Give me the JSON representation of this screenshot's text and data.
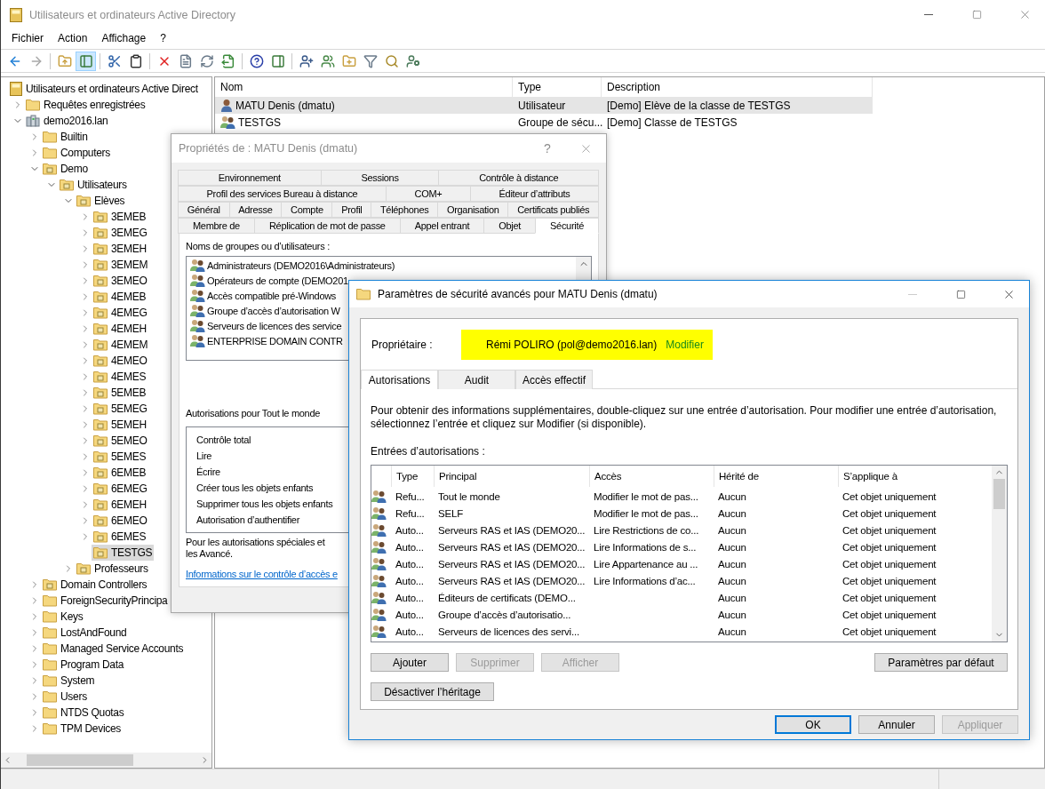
{
  "main_window": {
    "title": "Utilisateurs et ordinateurs Active Directory",
    "menu": [
      "Fichier",
      "Action",
      "Affichage",
      "?"
    ],
    "toolbar": [
      {
        "kind": "back",
        "pressed": false,
        "disabled": false
      },
      {
        "kind": "forward",
        "pressed": false,
        "disabled": true
      },
      {
        "kind": "separator"
      },
      {
        "kind": "up",
        "pressed": false,
        "disabled": false
      },
      {
        "kind": "tree",
        "pressed": true,
        "disabled": false
      },
      {
        "kind": "separator"
      },
      {
        "kind": "cut",
        "pressed": false,
        "disabled": false
      },
      {
        "kind": "paste",
        "pressed": false,
        "disabled": false
      },
      {
        "kind": "separator"
      },
      {
        "kind": "delete",
        "pressed": false,
        "disabled": false
      },
      {
        "kind": "properties",
        "pressed": false,
        "disabled": false
      },
      {
        "kind": "refresh",
        "pressed": false,
        "disabled": false
      },
      {
        "kind": "export",
        "pressed": false,
        "disabled": false
      },
      {
        "kind": "separator"
      },
      {
        "kind": "help",
        "pressed": false,
        "disabled": false
      },
      {
        "kind": "action_pane",
        "pressed": false,
        "disabled": false
      },
      {
        "kind": "separator"
      },
      {
        "kind": "new_user",
        "pressed": false,
        "disabled": false
      },
      {
        "kind": "new_group",
        "pressed": false,
        "disabled": false
      },
      {
        "kind": "new_ou",
        "pressed": false,
        "disabled": false
      },
      {
        "kind": "filter",
        "pressed": false,
        "disabled": false
      },
      {
        "kind": "find",
        "pressed": false,
        "disabled": false
      },
      {
        "kind": "add_to_group",
        "pressed": false,
        "disabled": false
      }
    ],
    "tree": {
      "label": "Utilisateurs et ordinateurs Active Direct",
      "kind": "snapin",
      "selected": false,
      "children": [
        {
          "label": "Requêtes enregistrées",
          "kind": "folder",
          "expanded": false,
          "selected": false
        },
        {
          "label": "demo2016.lan",
          "kind": "domain",
          "expanded": true,
          "selected": false,
          "children": [
            {
              "label": "Builtin",
              "kind": "folder",
              "expanded": false,
              "selected": false
            },
            {
              "label": "Computers",
              "kind": "folder",
              "expanded": false,
              "selected": false
            },
            {
              "label": "Demo",
              "kind": "ou",
              "expanded": true,
              "selected": false,
              "children": [
                {
                  "label": "Utilisateurs",
                  "kind": "ou",
                  "expanded": true,
                  "selected": false,
                  "children": [
                    {
                      "label": "Elèves",
                      "kind": "ou",
                      "expanded": true,
                      "selected": false,
                      "children": [
                        {
                          "label": "3EMEB",
                          "kind": "ou",
                          "expanded": false,
                          "selected": false
                        },
                        {
                          "label": "3EMEG",
                          "kind": "ou",
                          "expanded": false,
                          "selected": false
                        },
                        {
                          "label": "3EMEH",
                          "kind": "ou",
                          "expanded": false,
                          "selected": false
                        },
                        {
                          "label": "3EMEM",
                          "kind": "ou",
                          "expanded": false,
                          "selected": false
                        },
                        {
                          "label": "3EMEO",
                          "kind": "ou",
                          "expanded": false,
                          "selected": false
                        },
                        {
                          "label": "4EMEB",
                          "kind": "ou",
                          "expanded": false,
                          "selected": false
                        },
                        {
                          "label": "4EMEG",
                          "kind": "ou",
                          "expanded": false,
                          "selected": false
                        },
                        {
                          "label": "4EMEH",
                          "kind": "ou",
                          "expanded": false,
                          "selected": false
                        },
                        {
                          "label": "4EMEM",
                          "kind": "ou",
                          "expanded": false,
                          "selected": false
                        },
                        {
                          "label": "4EMEO",
                          "kind": "ou",
                          "expanded": false,
                          "selected": false
                        },
                        {
                          "label": "4EMES",
                          "kind": "ou",
                          "expanded": false,
                          "selected": false
                        },
                        {
                          "label": "5EMEB",
                          "kind": "ou",
                          "expanded": false,
                          "selected": false
                        },
                        {
                          "label": "5EMEG",
                          "kind": "ou",
                          "expanded": false,
                          "selected": false
                        },
                        {
                          "label": "5EMEH",
                          "kind": "ou",
                          "expanded": false,
                          "selected": false
                        },
                        {
                          "label": "5EMEO",
                          "kind": "ou",
                          "expanded": false,
                          "selected": false
                        },
                        {
                          "label": "5EMES",
                          "kind": "ou",
                          "expanded": false,
                          "selected": false
                        },
                        {
                          "label": "6EMEB",
                          "kind": "ou",
                          "expanded": false,
                          "selected": false
                        },
                        {
                          "label": "6EMEG",
                          "kind": "ou",
                          "expanded": false,
                          "selected": false
                        },
                        {
                          "label": "6EMEH",
                          "kind": "ou",
                          "expanded": false,
                          "selected": false
                        },
                        {
                          "label": "6EMEO",
                          "kind": "ou",
                          "expanded": false,
                          "selected": false
                        },
                        {
                          "label": "6EMES",
                          "kind": "ou",
                          "expanded": false,
                          "selected": false
                        },
                        {
                          "label": "TESTGS",
                          "kind": "ou",
                          "selected": true
                        }
                      ]
                    },
                    {
                      "label": "Professeurs",
                      "kind": "ou",
                      "expanded": false,
                      "selected": false
                    }
                  ]
                }
              ]
            },
            {
              "label": "Domain Controllers",
              "kind": "ou",
              "expanded": false,
              "selected": false
            },
            {
              "label": "ForeignSecurityPrincipa",
              "kind": "folder",
              "expanded": false,
              "selected": false
            },
            {
              "label": "Keys",
              "kind": "folder",
              "expanded": false,
              "selected": false
            },
            {
              "label": "LostAndFound",
              "kind": "folder",
              "expanded": false,
              "selected": false
            },
            {
              "label": "Managed Service Accounts",
              "kind": "folder",
              "expanded": false,
              "selected": false
            },
            {
              "label": "Program Data",
              "kind": "folder",
              "expanded": false,
              "selected": false
            },
            {
              "label": "System",
              "kind": "folder",
              "expanded": false,
              "selected": false
            },
            {
              "label": "Users",
              "kind": "folder",
              "expanded": false,
              "selected": false
            },
            {
              "label": "NTDS Quotas",
              "kind": "folder",
              "expanded": false,
              "selected": false
            },
            {
              "label": "TPM Devices",
              "kind": "folder",
              "expanded": false,
              "selected": false
            }
          ]
        }
      ]
    },
    "list": {
      "columns": [
        "Nom",
        "Type",
        "Description"
      ],
      "rows": [
        {
          "kind": "user",
          "name": "MATU Denis (dmatu)",
          "type": "Utilisateur",
          "description": "[Demo] Elève de la classe de TESTGS",
          "selected": true
        },
        {
          "kind": "group",
          "name": "TESTGS",
          "type": "Groupe de sécu...",
          "description": "[Demo] Classe de TESTGS",
          "selected": false
        }
      ]
    }
  },
  "properties_dialog": {
    "title": "Propriétés de : MATU Denis (dmatu)",
    "help": "?",
    "tab_rows": [
      [
        {
          "label": "Environnement",
          "selected": false
        },
        {
          "label": "Sessions",
          "selected": false
        },
        {
          "label": "Contrôle à distance",
          "selected": false
        }
      ],
      [
        {
          "label": "Profil des services Bureau à distance",
          "selected": false
        },
        {
          "label": "COM+",
          "selected": false
        },
        {
          "label": "Éditeur d’attributs",
          "selected": false
        }
      ],
      [
        {
          "label": "Général",
          "selected": false
        },
        {
          "label": "Adresse",
          "selected": false
        },
        {
          "label": "Compte",
          "selected": false
        },
        {
          "label": "Profil",
          "selected": false
        },
        {
          "label": "Téléphones",
          "selected": false
        },
        {
          "label": "Organisation",
          "selected": false
        },
        {
          "label": "Certificats publiés",
          "selected": false
        }
      ],
      [
        {
          "label": "Membre de",
          "selected": false
        },
        {
          "label": "Réplication de mot de passe",
          "selected": false
        },
        {
          "label": "Appel entrant",
          "selected": false
        },
        {
          "label": "Objet",
          "selected": false
        },
        {
          "label": "Sécurité",
          "selected": true
        }
      ]
    ],
    "groups_label": "Noms de groupes ou d’utilisateurs :",
    "groups": [
      "Administrateurs (DEMO2016\\Administrateurs)",
      "Opérateurs de compte (DEMO201",
      "Accès compatible pré-Windows",
      "Groupe d’accès d’autorisation W",
      "Serveurs de licences des service",
      "ENTERPRISE DOMAIN CONTR"
    ],
    "permissions_label": "Autorisations pour Tout le monde",
    "permissions": [
      "Contrôle total",
      "Lire",
      "Écrire",
      "Créer tous les objets enfants",
      "Supprimer tous les objets enfants",
      "Autorisation d’authentifier"
    ],
    "special_note": "Pour les autorisations spéciales et les Avancé.",
    "link": "Informations sur le contrôle d’accès e"
  },
  "advanced_dialog": {
    "title": "Paramètres de sécurité avancés pour MATU Denis (dmatu)",
    "owner_label": "Propriétaire :",
    "owner": "Rémi POLIRO (pol@demo2016.lan)",
    "owner_link": "Modifier",
    "tabs": [
      {
        "label": "Autorisations",
        "selected": true
      },
      {
        "label": "Audit",
        "selected": false
      },
      {
        "label": "Accès effectif",
        "selected": false
      }
    ],
    "description": "Pour obtenir des informations supplémentaires, double-cliquez sur une entrée d’autorisation. Pour modifier une entrée d’autorisation, sélectionnez l’entrée et cliquez sur Modifier (si disponible).",
    "entries_label": "Entrées d’autorisations :",
    "columns": [
      "Type",
      "Principal",
      "Accès",
      "Hérité de",
      "S’applique à"
    ],
    "entries": [
      {
        "type": "Refu...",
        "principal": "Tout le monde",
        "access": "Modifier le mot de pas...",
        "inherited": "Aucun",
        "applies": "Cet objet uniquement"
      },
      {
        "type": "Refu...",
        "principal": "SELF",
        "access": "Modifier le mot de pas...",
        "inherited": "Aucun",
        "applies": "Cet objet uniquement"
      },
      {
        "type": "Auto...",
        "principal": "Serveurs RAS et IAS (DEMO20...",
        "access": "Lire Restrictions de co...",
        "inherited": "Aucun",
        "applies": "Cet objet uniquement"
      },
      {
        "type": "Auto...",
        "principal": "Serveurs RAS et IAS (DEMO20...",
        "access": "Lire Informations de s...",
        "inherited": "Aucun",
        "applies": "Cet objet uniquement"
      },
      {
        "type": "Auto...",
        "principal": "Serveurs RAS et IAS (DEMO20...",
        "access": "Lire Appartenance au ...",
        "inherited": "Aucun",
        "applies": "Cet objet uniquement"
      },
      {
        "type": "Auto...",
        "principal": "Serveurs RAS et IAS (DEMO20...",
        "access": "Lire Informations d’ac...",
        "inherited": "Aucun",
        "applies": "Cet objet uniquement"
      },
      {
        "type": "Auto...",
        "principal": "Éditeurs de certificats (DEMO...",
        "inherited": "Aucun",
        "applies": "Cet objet uniquement"
      },
      {
        "type": "Auto...",
        "principal": "Groupe d’accès d’autorisatio...",
        "inherited": "Aucun",
        "applies": "Cet objet uniquement"
      },
      {
        "type": "Auto...",
        "principal": "Serveurs de licences des servi...",
        "inherited": "Aucun",
        "applies": "Cet objet uniquement"
      }
    ],
    "actions": [
      {
        "label": "Ajouter",
        "disabled": false
      },
      {
        "label": "Supprimer",
        "disabled": true
      },
      {
        "label": "Afficher",
        "disabled": true
      }
    ],
    "defaults_button": "Paramètres par défaut",
    "inheritance_button": "Désactiver l’héritage",
    "footer_buttons": [
      {
        "label": "OK",
        "disabled": false,
        "default": true
      },
      {
        "label": "Annuler",
        "disabled": false,
        "default": false
      },
      {
        "label": "Appliquer",
        "disabled": true,
        "default": false
      }
    ]
  }
}
